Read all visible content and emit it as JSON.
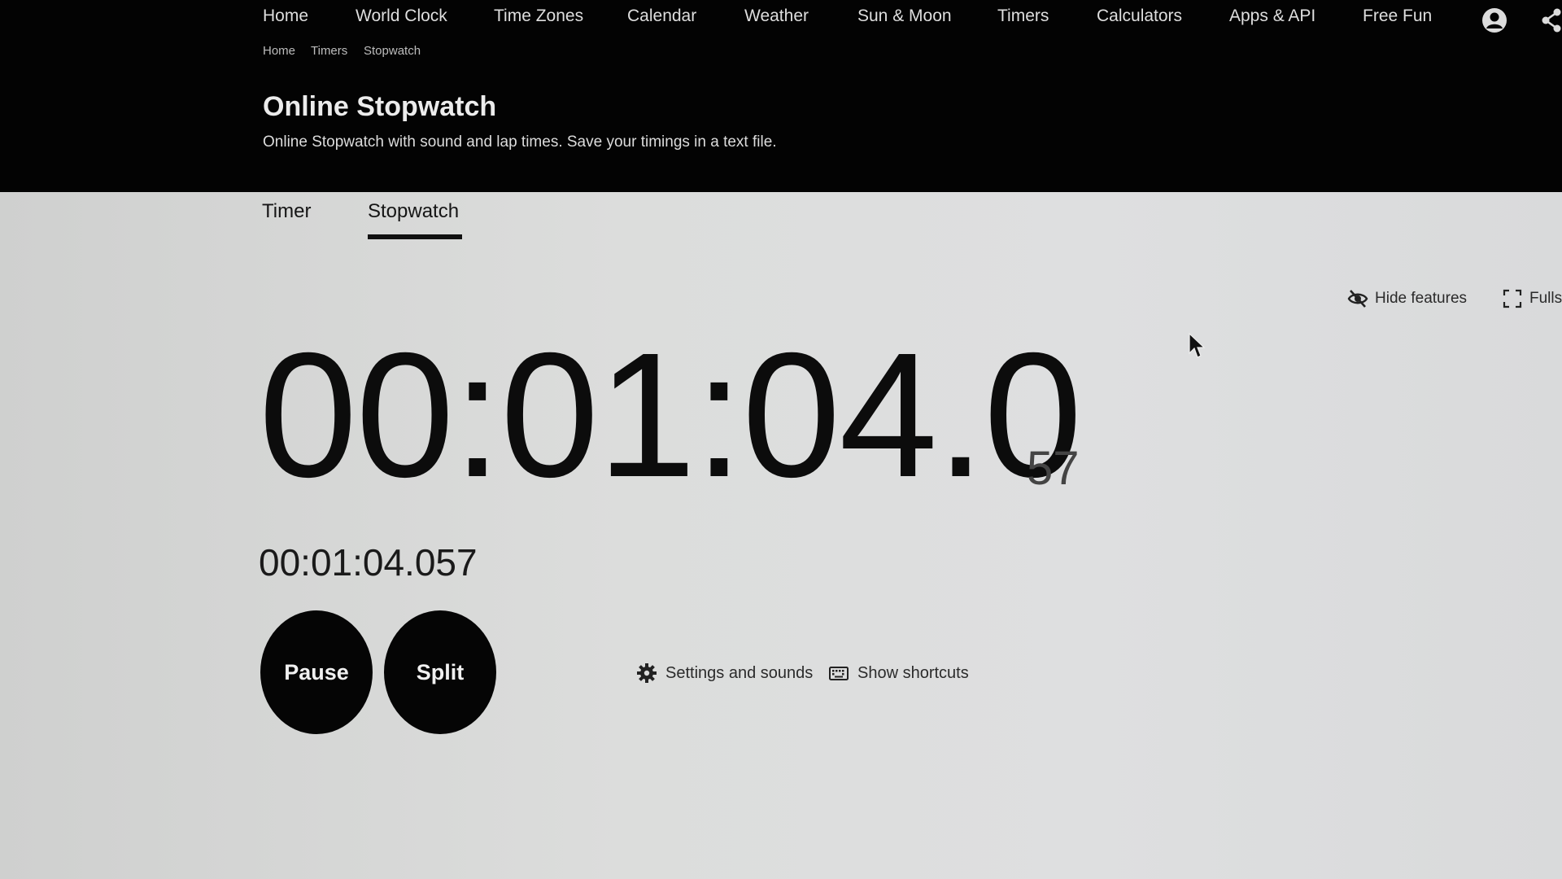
{
  "nav": {
    "items": [
      {
        "id": "home",
        "label": "Home"
      },
      {
        "id": "world-clock",
        "label": "World Clock"
      },
      {
        "id": "time-zones",
        "label": "Time Zones"
      },
      {
        "id": "calendar",
        "label": "Calendar"
      },
      {
        "id": "weather",
        "label": "Weather"
      },
      {
        "id": "sun-moon",
        "label": "Sun & Moon"
      },
      {
        "id": "timers",
        "label": "Timers"
      },
      {
        "id": "calculators",
        "label": "Calculators"
      },
      {
        "id": "apps-api",
        "label": "Apps & API"
      },
      {
        "id": "free-fun",
        "label": "Free Fun"
      }
    ],
    "account_icon": "user-circle-icon",
    "share_icon": "share-icon"
  },
  "breadcrumb": [
    "Home",
    "Timers",
    "Stopwatch"
  ],
  "header": {
    "title": "Online Stopwatch",
    "subtitle": "Online Stopwatch with sound and lap times. Save your timings in a text file."
  },
  "tabs": {
    "items": [
      "Timer",
      "Stopwatch"
    ],
    "active": "Stopwatch"
  },
  "features": {
    "hide_label": "Hide features",
    "fullscreen_label": "Fulls",
    "hide_icon": "eye-slash-icon",
    "fullscreen_icon": "expand-icon"
  },
  "stopwatch": {
    "main_display": "00:01:04.0",
    "ms_display": "57",
    "full_time": "00:01:04.057"
  },
  "controls": {
    "pause_label": "Pause",
    "split_label": "Split",
    "settings_label": "Settings and sounds",
    "shortcuts_label": "Show shortcuts",
    "settings_icon": "gear-icon",
    "shortcuts_icon": "keyboard-icon"
  },
  "colors": {
    "header_bg": "#030303",
    "content_bg": "#d6d7d6",
    "button_bg": "#050505"
  }
}
